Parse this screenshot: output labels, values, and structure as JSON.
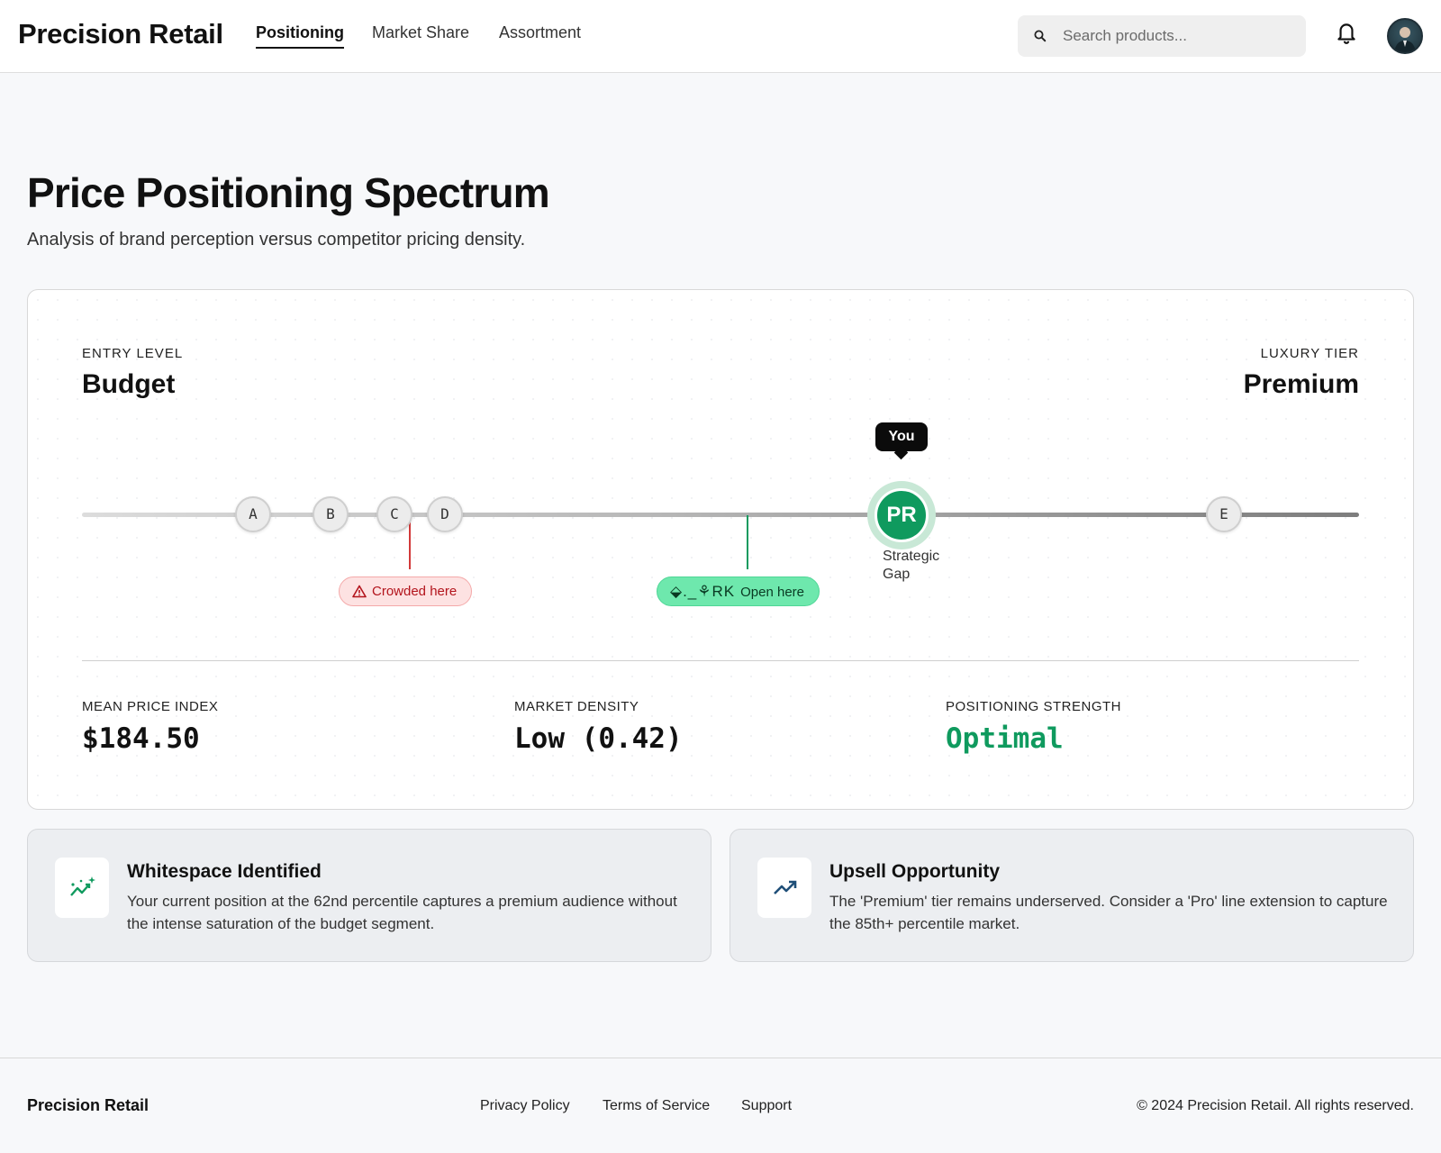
{
  "header": {
    "brand": "Precision Retail",
    "tabs": [
      {
        "label": "Positioning",
        "active": true
      },
      {
        "label": "Market Share",
        "active": false
      },
      {
        "label": "Assortment",
        "active": false
      }
    ],
    "search": {
      "placeholder": "Search products..."
    },
    "icons": {
      "search": "search-icon",
      "notifications": "bell-icon",
      "avatar": "user-avatar"
    }
  },
  "page": {
    "title": "Price Positioning Spectrum",
    "subtitle": "Analysis of brand perception versus competitor pricing density."
  },
  "spectrum": {
    "left": {
      "caption": "ENTRY LEVEL",
      "name": "Budget"
    },
    "right": {
      "caption": "LUXURY TIER",
      "name": "Premium"
    },
    "competitors": [
      "A",
      "B",
      "C",
      "D",
      "E"
    ],
    "you": {
      "tooltip": "You",
      "initials": "PR",
      "label": "Strategic Gap"
    },
    "crowded_label": "Crowded here",
    "open_glyphs": "⬙._⚘RK",
    "open_label": "Open here",
    "colors": {
      "accent": "#0f9a5e",
      "crowded": "#b3141c",
      "open": "#6ee8ad"
    }
  },
  "metrics": [
    {
      "caption": "MEAN PRICE INDEX",
      "value": "$184.50"
    },
    {
      "caption": "MARKET DENSITY",
      "value": "Low (0.42)"
    },
    {
      "caption": "POSITIONING STRENGTH",
      "value": "Optimal"
    }
  ],
  "insights": [
    {
      "icon": "sparkle-trend-icon",
      "title": "Whitespace Identified",
      "body": "Your current position at the 62nd percentile captures a premium audience without the intense saturation of the budget segment."
    },
    {
      "icon": "trending-up-icon",
      "title": "Upsell Opportunity",
      "body": "The 'Premium' tier remains underserved. Consider a 'Pro' line extension to capture the 85th+ percentile market."
    }
  ],
  "footer": {
    "brand": "Precision Retail",
    "links": [
      "Privacy Policy",
      "Terms of Service",
      "Support"
    ],
    "copyright": "© 2024 Precision Retail. All rights reserved."
  }
}
